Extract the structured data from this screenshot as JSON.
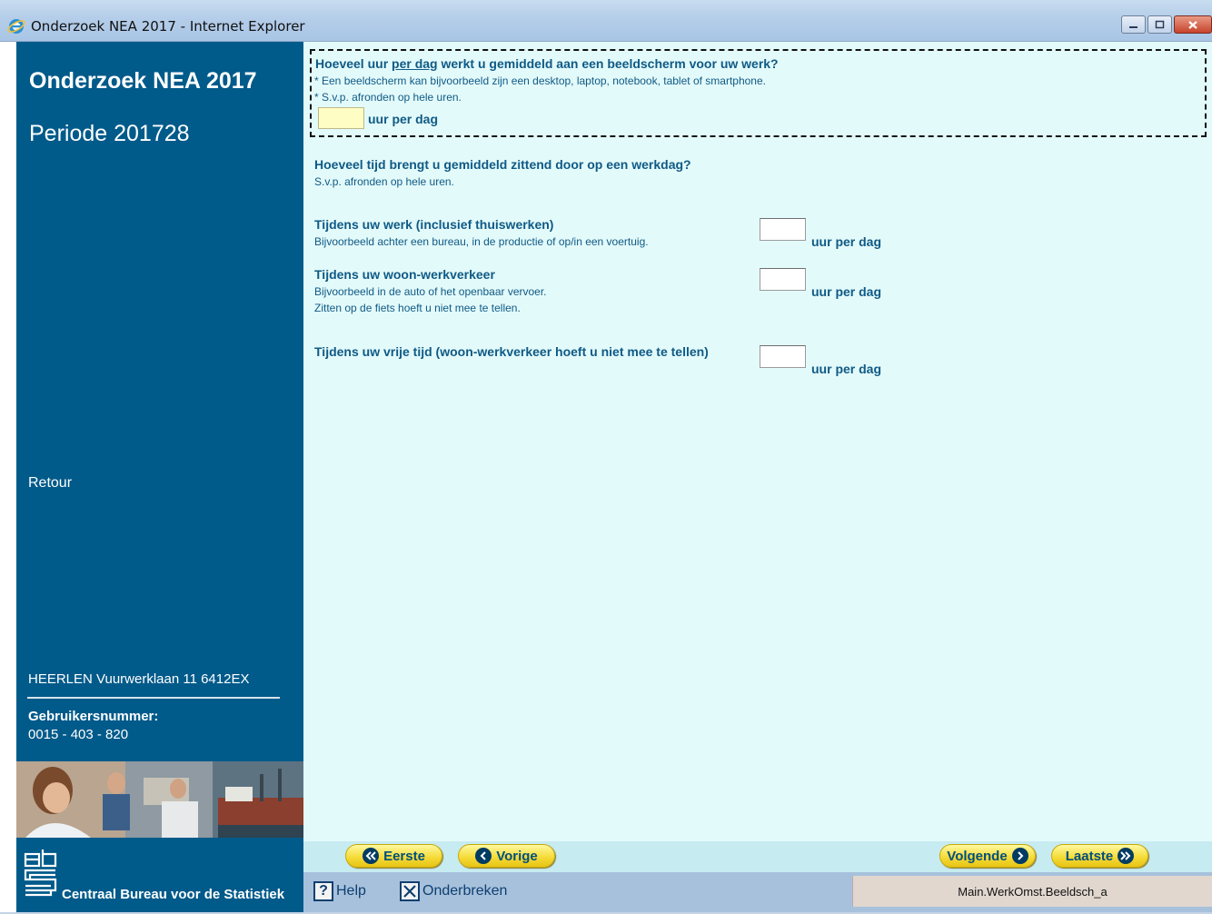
{
  "window": {
    "title": "Onderzoek NEA 2017 - Internet Explorer"
  },
  "sidebar": {
    "title": "Onderzoek NEA 2017",
    "period": "Periode 201728",
    "retour": "Retour",
    "address": "HEERLEN Vuurwerklaan 11 6412EX",
    "user_label": "Gebruikersnummer:",
    "user_number": "0015 - 403 - 820",
    "org_name": "Centraal Bureau voor de Statistiek"
  },
  "q1": {
    "title_pre": "Hoeveel uur ",
    "title_underline": "per dag",
    "title_post": " werkt u gemiddeld aan een beeldscherm voor uw werk?",
    "note1": "* Een beeldscherm kan bijvoorbeeld zijn een desktop, laptop, notebook, tablet of smartphone.",
    "note2": "* S.v.p. afronden op hele uren.",
    "value": "",
    "unit": "uur per dag"
  },
  "q2": {
    "title": "Hoeveel tijd brengt u gemiddeld zittend door op een werkdag?",
    "note": "S.v.p. afronden op hele uren.",
    "items": [
      {
        "title": "Tijdens uw werk (inclusief thuiswerken)",
        "note1": "Bijvoorbeeld achter een bureau, in de productie of op/in een voertuig.",
        "note2": "",
        "value": "",
        "unit": "uur per dag"
      },
      {
        "title": "Tijdens uw woon-werkverkeer",
        "note1": "Bijvoorbeeld in de auto of het openbaar vervoer.",
        "note2": "Zitten op de fiets hoeft u niet mee te tellen.",
        "value": "",
        "unit": "uur per dag"
      },
      {
        "title": "Tijdens uw vrije tijd (woon-werkverkeer hoeft u niet mee te tellen)",
        "note1": "",
        "note2": "",
        "value": "",
        "unit": "uur per dag"
      }
    ]
  },
  "nav": {
    "first": "Eerste",
    "prev": "Vorige",
    "next": "Volgende",
    "last": "Laatste"
  },
  "status": {
    "help": "Help",
    "abort": "Onderbreken",
    "field_name": "Main.WerkOmst.Beeldsch_a"
  },
  "colors": {
    "sidebar": "#005a8a",
    "content_bg": "#e3fafa",
    "question_text": "#0f5a86",
    "nav_button": "#f5dc3a",
    "active_input": "#fefdc3"
  }
}
